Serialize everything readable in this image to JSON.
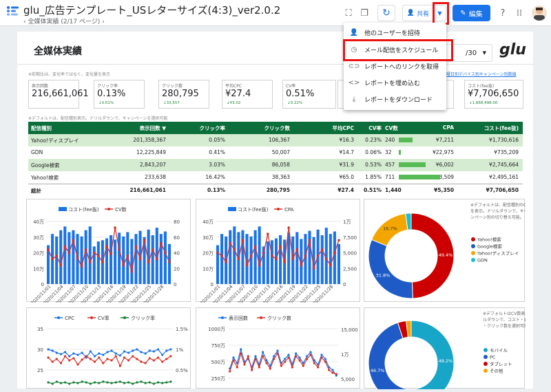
{
  "header": {
    "title": "glu_広告テンプレート_USレターサイズ(4:3)_ver2.0.2",
    "breadcrumb": "全媒体実績",
    "page_indicator": "(2/17 ページ)",
    "share_label": "共有",
    "edit_label": "編集",
    "icons": [
      "fullscreen-icon",
      "copy-icon",
      "refresh-icon",
      "add-person-icon",
      "dropdown-icon",
      "pencil-icon",
      "help-icon",
      "apps-icon",
      "avatar"
    ]
  },
  "menu": {
    "items": [
      {
        "icon": "add-person-icon",
        "label": "他のユーザーを招待"
      },
      {
        "icon": "clock-icon",
        "label": "メール配信をスケジュール"
      },
      {
        "icon": "link-icon",
        "label": "レポートへのリンクを取得"
      },
      {
        "icon": "code-icon",
        "label": "レポートを埋め込む"
      },
      {
        "icon": "download-icon",
        "label": "レポートをダウンロード"
      }
    ]
  },
  "page": {
    "title": "全媒体実績",
    "date_fragment": "/30",
    "brand": "glu",
    "note_top": "※前期比は、変化率ではなく、変化量を表示",
    "note_top_right": "曜日別デバイス別キャンペーン別数値",
    "note_table": "※デフォルトは、配信種別表示。ドリルダウンで、キャンペーンを選択可能"
  },
  "kpis": [
    {
      "label": "表示回数",
      "value": "216,661,061",
      "delta": ""
    },
    {
      "label": "クリック率",
      "value": "0.13%",
      "delta": "↓0.01%"
    },
    {
      "label": "クリック数",
      "value": "280,795",
      "delta": "↓33,557"
    },
    {
      "label": "平均CPC",
      "value": "¥27.4",
      "delta": "↓¥3.02"
    },
    {
      "label": "CV率",
      "value": "0.51%",
      "delta": "↓0.22%"
    },
    {
      "label": "コスト(fee抜)",
      "value": "¥7,706,650",
      "delta": "↓1,668,498.00"
    }
  ],
  "table": {
    "headers": [
      "配信種別",
      "表示回数 ▼",
      "クリック率",
      "クリック数",
      "平均CPC",
      "CV率",
      "CV数",
      "CPA",
      "コスト(fee抜)"
    ],
    "rows": [
      [
        "Yahoo!ディスプレイ",
        "201,358,367",
        "0.05%",
        "106,367",
        "¥16.3",
        "0.23%",
        "240",
        "¥7,211",
        "¥1,730,616"
      ],
      [
        "GDN",
        "12,225,849",
        "0.41%",
        "50,007",
        "¥14.7",
        "0.06%",
        "32",
        "¥22,975",
        "¥735,209"
      ],
      [
        "Google検索",
        "2,843,207",
        "3.03%",
        "86,058",
        "¥31.9",
        "0.53%",
        "457",
        "¥6,002",
        "¥2,745,664"
      ],
      [
        "Yahoo!検索",
        "233,638",
        "16.42%",
        "38,363",
        "¥65.0",
        "1.85%",
        "711",
        "¥3,509",
        "¥2,495,161"
      ],
      [
        "総計",
        "216,661,061",
        "0.13%",
        "280,795",
        "¥27.4",
        "0.51%",
        "1,440",
        "¥5,350",
        "¥7,706,650"
      ]
    ],
    "cv_values": [
      240,
      32,
      457,
      711
    ],
    "cv_max": 711
  },
  "charts": {
    "c1": {
      "legend": [
        "コスト(fee抜)",
        "CV数"
      ],
      "left_ticks": [
        "40万",
        "30万",
        "20万",
        "10万",
        "0"
      ],
      "right_ticks": [
        "80",
        "60",
        "40",
        "20",
        "0"
      ],
      "x_ticks": [
        "2020/11/01",
        "2020/11/04",
        "2020/11/07",
        "2020/11/10",
        "2020/11/13",
        "2020/11/16",
        "2020/11/19",
        "2020/11/22",
        "2020/11/25",
        "2020/11/28"
      ]
    },
    "c2": {
      "legend": [
        "コスト(fee抜)",
        "CPA"
      ],
      "left_ticks": [
        "40万",
        "30万",
        "20万",
        "10万",
        "0"
      ],
      "right_ticks": [
        "1万",
        "7,500",
        "5,000",
        "2,500",
        "0"
      ],
      "x_ticks": [
        "2020/11/01",
        "2020/11/04",
        "2020/11/07",
        "2020/11/10",
        "2020/11/13",
        "2020/11/16",
        "2020/11/19",
        "2020/11/22",
        "2020/11/25",
        "2020/11/28"
      ]
    },
    "c3": {
      "note": "※デフォルトは、配信種別のCV数を表示。ドリルダウンで、キャンペーン別の切り替え可能。",
      "slices": [
        {
          "label": "Yahoo!検索",
          "value": 49.4,
          "color": "#cc0000"
        },
        {
          "label": "Google検索",
          "value": 31.8,
          "color": "#1e5bc6"
        },
        {
          "label": "Yahoo!ディスプレイ",
          "value": 16.7,
          "color": "#f4a600"
        },
        {
          "label": "GDN",
          "value": 2.1,
          "color": "#17becf"
        }
      ],
      "labels": [
        "49.4%",
        "31.8%",
        "16.7%"
      ]
    },
    "c4": {
      "legend": [
        "CPC",
        "CV率",
        "クリック率"
      ],
      "left_ticks": [
        "35",
        "30",
        "25"
      ],
      "right_ticks": [
        "1.5%",
        "1%",
        "0.5%"
      ]
    },
    "c5": {
      "legend": [
        "表示回数",
        "クリック数"
      ],
      "left_ticks": [
        "1000万",
        "750万",
        "500万",
        "250万"
      ],
      "right_ticks": [
        "15,000",
        "1万",
        "5,000"
      ]
    },
    "c6": {
      "note": "※デフォルトはCV数表示。ドリルダウンで、コスト・表示回数・クリック数を選択可能",
      "slices": [
        {
          "label": "モバイル",
          "value": 48.2,
          "color": "#17a5c8"
        },
        {
          "label": "PC",
          "value": 46.7,
          "color": "#1e5bc6"
        },
        {
          "label": "タブレット",
          "value": 3.2,
          "color": "#cc0000"
        },
        {
          "label": "その他",
          "value": 1.9,
          "color": "#f4a600"
        }
      ],
      "labels": [
        "48.2%",
        "46.7%"
      ]
    }
  }
}
